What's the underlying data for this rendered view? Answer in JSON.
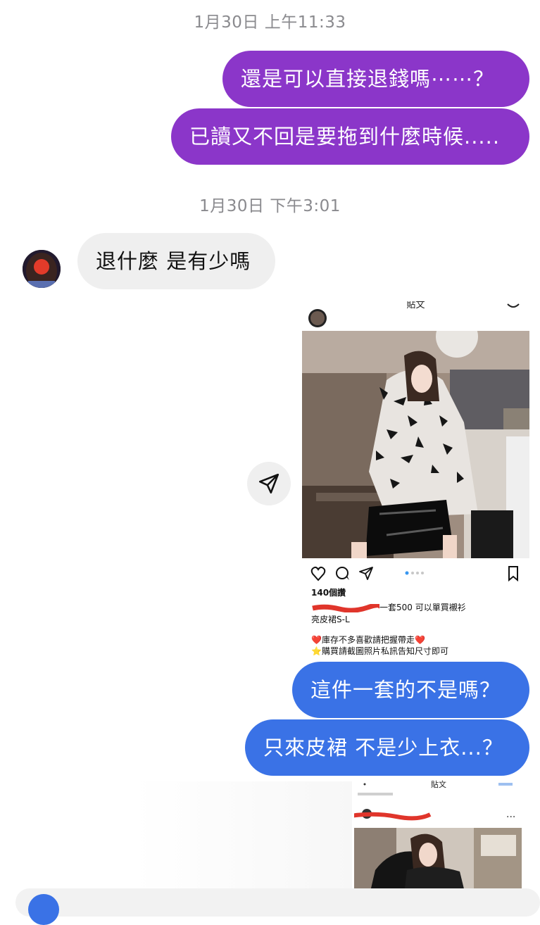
{
  "timestamps": [
    "1月30日 上午11:33",
    "1月30日 下午3:01"
  ],
  "messages": {
    "m1": "還是可以直接退錢嗎⋯⋯？",
    "m2": "已讀又不回是要拖到什麼時候.....",
    "m3": "退什麼 是有少嗎",
    "m4": "這件一套的不是嗎？",
    "m5": "只來皮裙 不是少上衣...？"
  },
  "shared_post": {
    "header_title": "貼文",
    "likes": "140個讚",
    "caption_line1": "一套500 可以單買襯衫",
    "caption_line2": "亮皮裙S-L",
    "caption_line3": "❤️庫存不多喜歡請把握帶走❤️",
    "caption_line4": "⭐購買請截圖照片私訊告知尺寸即可"
  },
  "shared_post_2": {
    "header_title": "貼文",
    "dots": "..."
  },
  "colors": {
    "outgoing_purple": "#8b36c9",
    "outgoing_blue": "#3a72e6",
    "incoming_gray": "#efefef",
    "timestamp_gray": "#8a8a8e"
  },
  "icons": [
    "send-icon",
    "heart-icon",
    "comment-icon",
    "share-icon",
    "bookmark-icon"
  ]
}
